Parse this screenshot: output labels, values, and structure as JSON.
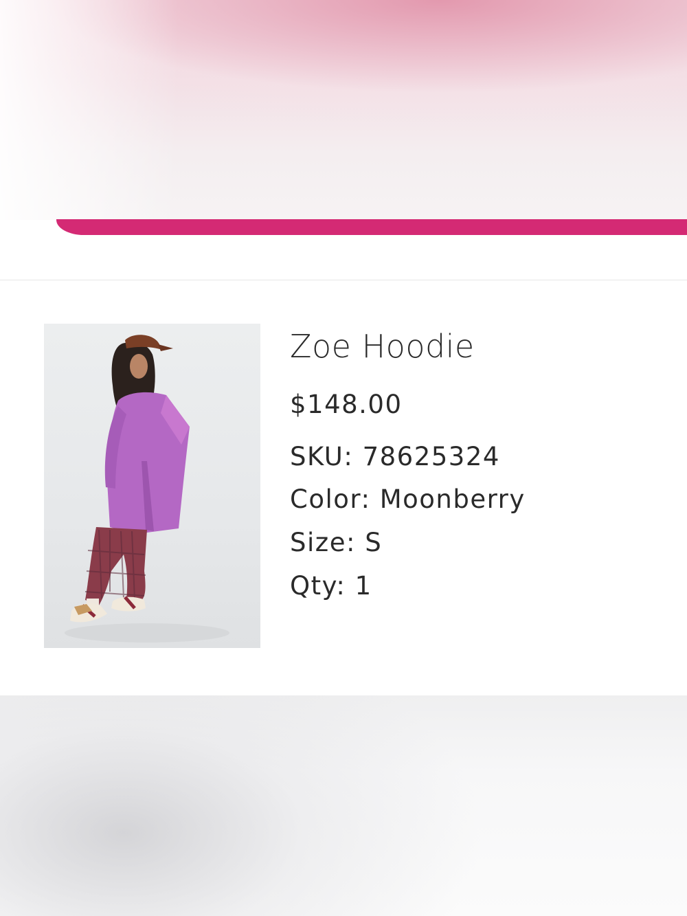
{
  "product": {
    "title": "Zoe Hoodie",
    "price": "$148.00",
    "sku_label": "SKU:",
    "sku_value": "78625324",
    "color_label": "Color:",
    "color_value": "Moonberry",
    "size_label": "Size:",
    "size_value": "S",
    "qty_label": "Qty:",
    "qty_value": "1"
  },
  "colors": {
    "accent": "#d42a74",
    "divider": "#e6e6e6",
    "text": "#2a2a2a"
  }
}
